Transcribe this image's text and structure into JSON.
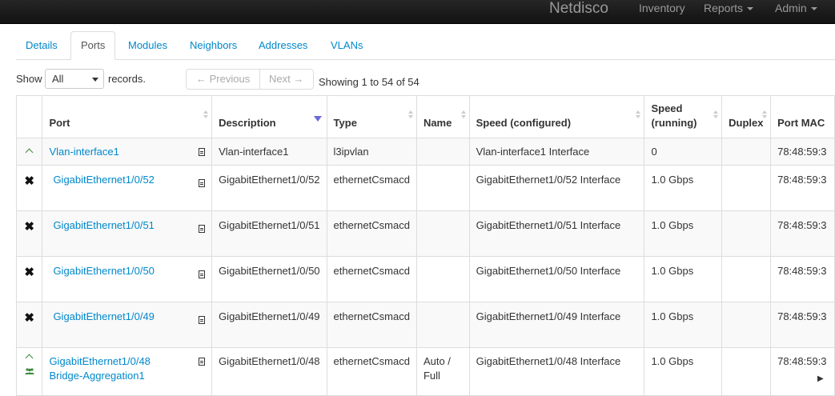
{
  "navbar": {
    "brand": "Netdisco",
    "inventory": "Inventory",
    "reports": "Reports",
    "admin": "Admin"
  },
  "tabs": [
    "Details",
    "Ports",
    "Modules",
    "Neighbors",
    "Addresses",
    "VLANs"
  ],
  "active_tab": "Ports",
  "controls": {
    "show_label": "Show",
    "page_length": "All",
    "records_label": "records.",
    "previous": "← Previous",
    "next": "Next →",
    "info": "Showing 1 to 54 of 54"
  },
  "table": {
    "headers": {
      "port": "Port",
      "description": "Description",
      "type": "Type",
      "name": "Name",
      "speed_configured": "Speed (configured)",
      "speed_running": "Speed (running)",
      "duplex": "Duplex",
      "port_mac": "Port MAC"
    },
    "rows": [
      {
        "status": "up",
        "port": "Vlan-interface1",
        "description": "Vlan-interface1",
        "type": "l3ipvlan",
        "name": "",
        "speed_configured": "Vlan-interface1 Interface",
        "speed_running": "0",
        "duplex": "",
        "port_mac": "78:48:59:3"
      },
      {
        "status": "down",
        "port": "GigabitEthernet1/0/52",
        "description": "GigabitEthernet1/0/52",
        "type": "ethernetCsmacd",
        "name": "",
        "speed_configured": "GigabitEthernet1/0/52 Interface",
        "speed_running": "1.0 Gbps",
        "duplex": "",
        "port_mac": "78:48:59:3"
      },
      {
        "status": "down",
        "port": "GigabitEthernet1/0/51",
        "description": "GigabitEthernet1/0/51",
        "type": "ethernetCsmacd",
        "name": "",
        "speed_configured": "GigabitEthernet1/0/51 Interface",
        "speed_running": "1.0 Gbps",
        "duplex": "",
        "port_mac": "78:48:59:3"
      },
      {
        "status": "down",
        "port": "GigabitEthernet1/0/50",
        "description": "GigabitEthernet1/0/50",
        "type": "ethernetCsmacd",
        "name": "",
        "speed_configured": "GigabitEthernet1/0/50 Interface",
        "speed_running": "1.0 Gbps",
        "duplex": "",
        "port_mac": "78:48:59:3"
      },
      {
        "status": "down",
        "port": "GigabitEthernet1/0/49",
        "description": "GigabitEthernet1/0/49",
        "type": "ethernetCsmacd",
        "name": "",
        "speed_configured": "GigabitEthernet1/0/49 Interface",
        "speed_running": "1.0 Gbps",
        "duplex": "",
        "port_mac": "78:48:59:3"
      },
      {
        "status": "up",
        "port": "GigabitEthernet1/0/48",
        "port_sub": "Bridge-Aggregation1",
        "description": "GigabitEthernet1/0/48",
        "type": "ethernetCsmacd",
        "name": "Auto / Full",
        "speed_configured": "GigabitEthernet1/0/48 Interface",
        "speed_running": "1.0 Gbps",
        "duplex": "",
        "port_mac": "78:48:59:3"
      }
    ]
  },
  "colors": {
    "link": "#0088cc",
    "navbar": "#1b1b1b",
    "up_icon": "#3a8a3a",
    "sort_active": "#6a6adf"
  }
}
